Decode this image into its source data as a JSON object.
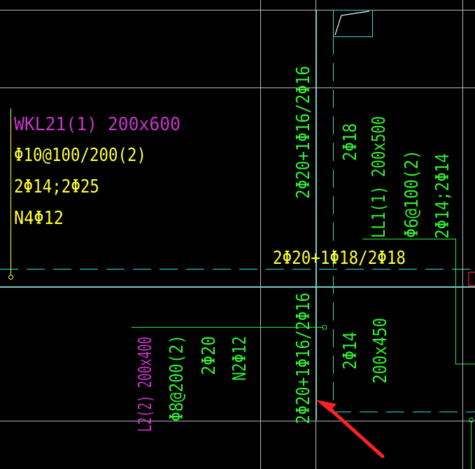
{
  "colors": {
    "background": "#000000",
    "grid": "#b8b8b8",
    "beam_edge": "#33dddd",
    "leader": "#33ee33",
    "magenta_text": "#cc33cc",
    "yellow_text": "#ffff33",
    "green_text": "#33ee33",
    "arrow": "#ff2222",
    "column_mark": "#ff2222"
  },
  "wkl21": {
    "name": "WKL21(1) 200x600",
    "stirrup": "Φ10@100/200(2)",
    "longitudinal": "2Φ14;2Φ25",
    "side": "N4Φ12"
  },
  "horizontal_beam_top_bar": "2Φ20+1Φ18/2Φ18",
  "vertical_beam": {
    "bottom_bar_upper": "2Φ20+1Φ16/2Φ16",
    "bottom_bar_lower": "2Φ20+1Φ16/2Φ16",
    "bar_upper": "2Φ18",
    "bar_lower": "2Φ14",
    "size_lower": "200x450"
  },
  "ll1": {
    "name": "LL1(1) 200x500",
    "stirrup": "Φ6@100(2)",
    "longitudinal": "2Φ14;2Φ14"
  },
  "l2": {
    "name": "L2(2) 200x400",
    "stirrup": "Φ8@200(2)",
    "longitudinal": "2Φ20",
    "side": "N2Φ12"
  },
  "annotation_arrow": "red-arrow-icon"
}
